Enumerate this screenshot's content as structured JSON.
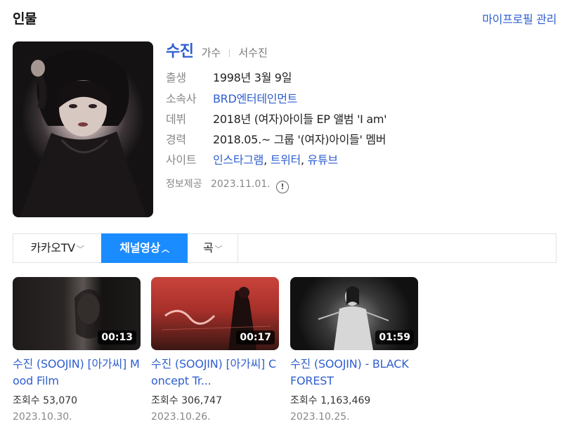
{
  "header": {
    "title": "인물",
    "profile_link": "마이프로필 관리"
  },
  "person": {
    "name": "수진",
    "job": "가수",
    "real_name": "서수진",
    "rows": [
      {
        "label": "출생",
        "value": "1998년 3월 9일"
      },
      {
        "label": "소속사",
        "value": "BRD엔터테인먼트"
      },
      {
        "label": "데뷔",
        "value": "2018년 (여자)아이들 EP 앨범 'I am'"
      },
      {
        "label": "경력",
        "value": "2018.05.~ 그룹 '(여자)아이들' 멤버"
      },
      {
        "label": "사이트",
        "links": [
          "인스타그램",
          "트위터",
          "유튜브"
        ],
        "separator": ", "
      }
    ],
    "source_label": "정보제공",
    "source_date": "2023.11.01.",
    "info_icon": "!"
  },
  "tabs": [
    {
      "label": "카카오TV",
      "chevron": "﹀"
    },
    {
      "label": "채널영상",
      "chevron": "︿"
    },
    {
      "label": "곡",
      "chevron": "﹀"
    }
  ],
  "videos": [
    {
      "title": "수진 (SOOJIN) [아가씨] Mood Film",
      "duration": "00:13",
      "views": "조회수 53,070",
      "date": "2023.10.30."
    },
    {
      "title": "수진 (SOOJIN) [아가씨] Concept Tr...",
      "duration": "00:17",
      "views": "조회수 306,747",
      "date": "2023.10.26."
    },
    {
      "title": "수진 (SOOJIN) - BLACK FOREST",
      "duration": "01:59",
      "views": "조회수 1,163,469",
      "date": "2023.10.25."
    }
  ]
}
